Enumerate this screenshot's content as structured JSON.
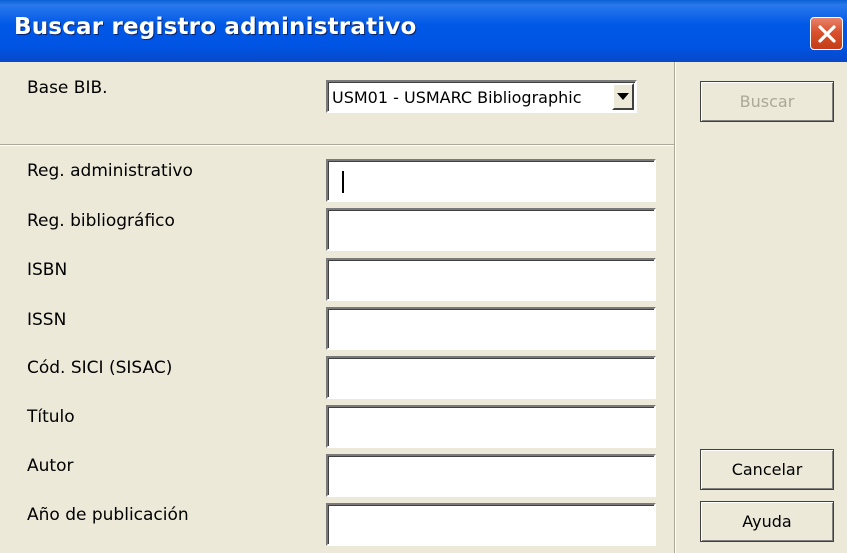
{
  "window": {
    "title": "Buscar registro administrativo",
    "title_color": "#0054e3"
  },
  "icons": {
    "close": "close-icon",
    "dropdown": "chevron-down-icon"
  },
  "form": {
    "base_bib_label": "Base BIB.",
    "base_bib_value": "USM01 - USMARC Bibliographic",
    "fields": [
      {
        "label": "Reg. administrativo",
        "value": ""
      },
      {
        "label": "Reg. bibliográfico",
        "value": ""
      },
      {
        "label": "ISBN",
        "value": ""
      },
      {
        "label": "ISSN",
        "value": ""
      },
      {
        "label": "Cód. SICI (SISAC)",
        "value": ""
      },
      {
        "label": "Título",
        "value": ""
      },
      {
        "label": "Autor",
        "value": ""
      },
      {
        "label": "Año de publicación",
        "value": ""
      }
    ]
  },
  "buttons": {
    "search": "Buscar",
    "cancel": "Cancelar",
    "help": "Ayuda"
  }
}
